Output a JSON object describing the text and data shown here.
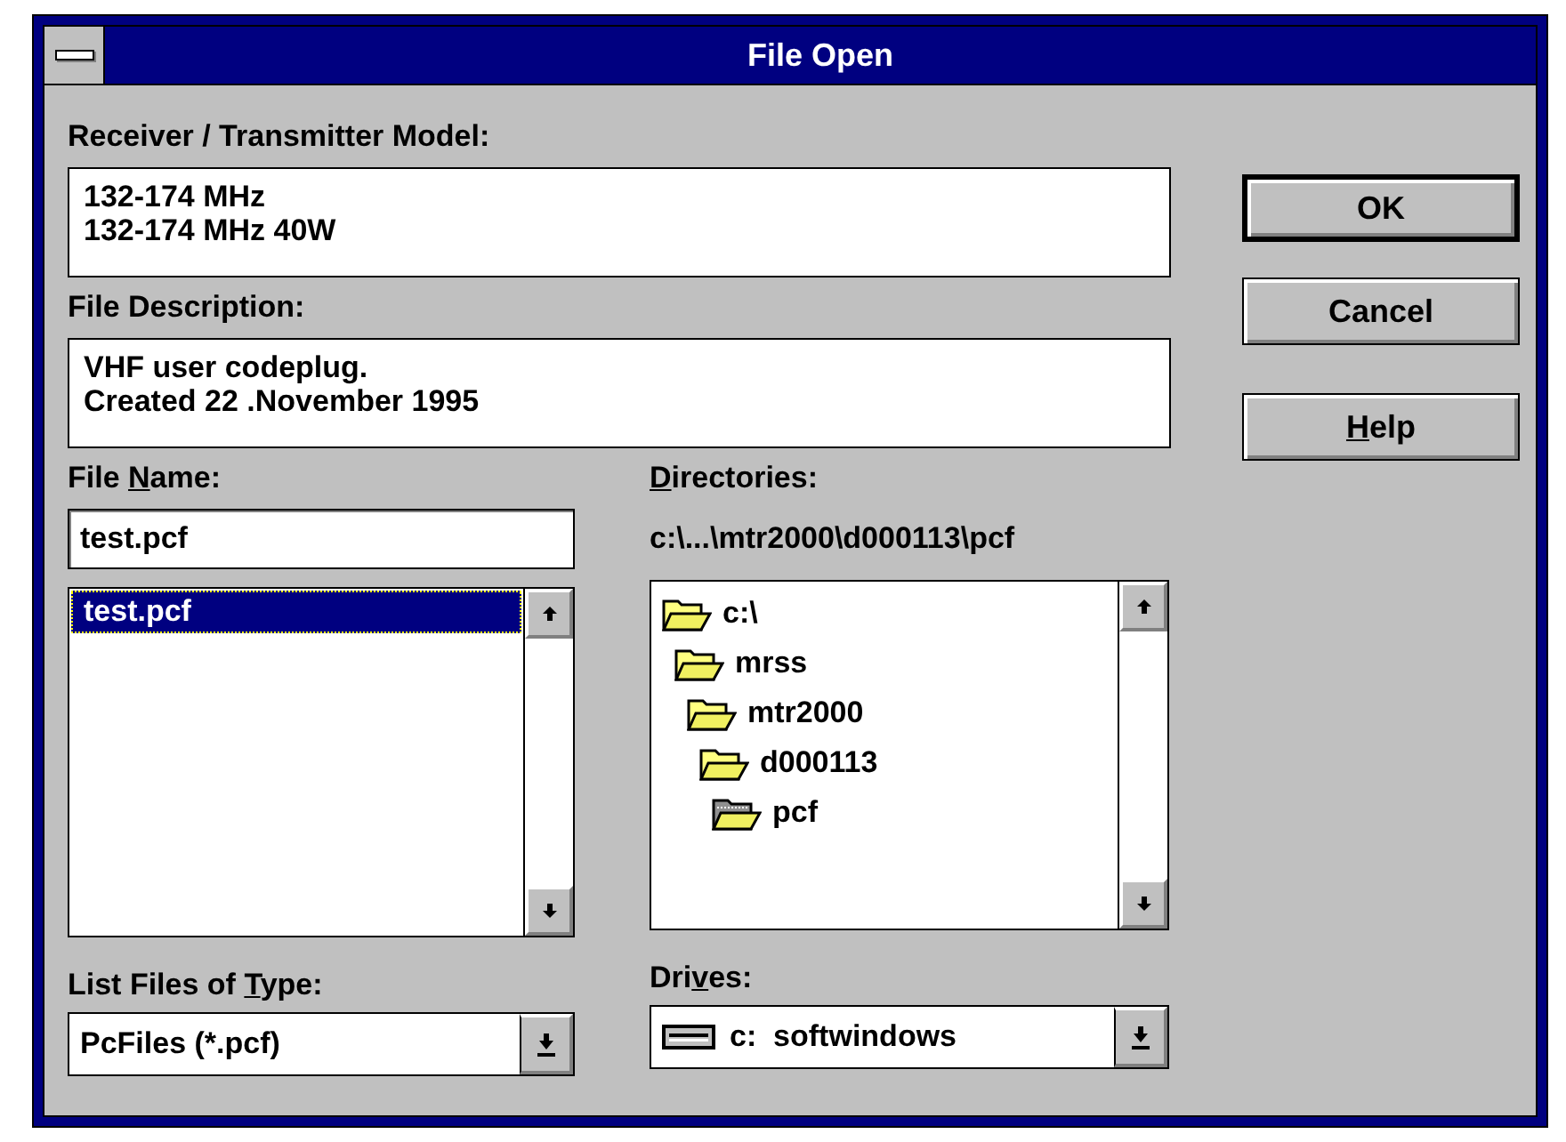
{
  "window": {
    "title": "File Open"
  },
  "model": {
    "label": {
      "text": "Receiver / Transmitter Model:"
    },
    "lines": [
      "132-174 MHz",
      "132-174 MHz 40W"
    ]
  },
  "description": {
    "label": {
      "text": "File Description:"
    },
    "lines": [
      "VHF user codeplug.",
      "Created 22 .November 1995"
    ]
  },
  "file_name": {
    "label": {
      "text": "File ",
      "key": "N",
      "rest": "ame:"
    },
    "value": "test.pcf"
  },
  "files": [
    {
      "name": "test.pcf",
      "selected": true
    }
  ],
  "directories": {
    "label": {
      "key": "D",
      "rest": "irectories:"
    },
    "path": "c:\\...\\mtr2000\\d000113\\pcf",
    "tree": [
      {
        "name": "c:\\",
        "current": false,
        "children": [
          {
            "name": "mrss",
            "current": false,
            "children": [
              {
                "name": "mtr2000",
                "current": false,
                "children": [
                  {
                    "name": "d000113",
                    "current": false,
                    "children": [
                      {
                        "name": "pcf",
                        "current": true
                      }
                    ]
                  }
                ]
              }
            ]
          }
        ]
      }
    ]
  },
  "file_type": {
    "label": {
      "text": "List Files of ",
      "key": "T",
      "rest": "ype:"
    },
    "value": "PcFiles (*.pcf)"
  },
  "drives": {
    "label": {
      "text": "Dri",
      "key": "v",
      "rest": "es:"
    },
    "value": "c:  softwindows"
  },
  "buttons": [
    {
      "label": {
        "text": "OK"
      },
      "default": true
    },
    {
      "label": {
        "text": "Cancel"
      },
      "default": false
    },
    {
      "label": {
        "key": "H",
        "rest": "elp"
      },
      "default": false
    }
  ]
}
